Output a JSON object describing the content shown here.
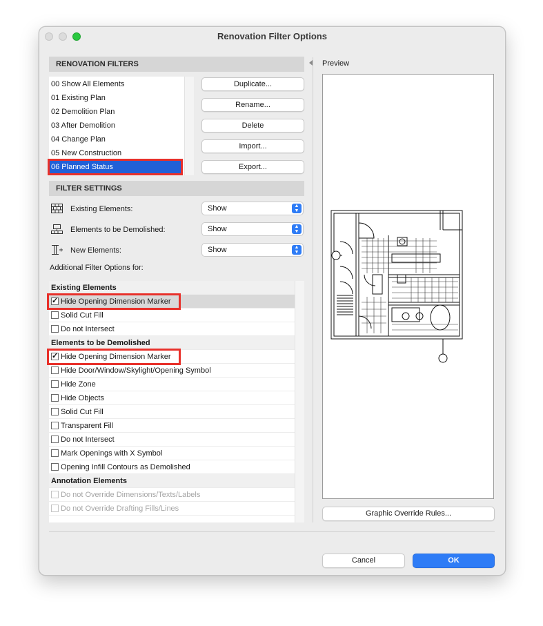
{
  "window": {
    "title": "Renovation Filter Options"
  },
  "renovation_filters": {
    "header": "RENOVATION FILTERS",
    "items": [
      {
        "label": "00 Show All Elements"
      },
      {
        "label": "01 Existing Plan"
      },
      {
        "label": "02 Demolition Plan"
      },
      {
        "label": "03 After Demolition"
      },
      {
        "label": "04 Change Plan"
      },
      {
        "label": "05 New Construction"
      },
      {
        "label": "06 Planned Status"
      }
    ],
    "selected_index": 6,
    "buttons": {
      "duplicate": "Duplicate...",
      "rename": "Rename...",
      "delete": "Delete",
      "import": "Import...",
      "export": "Export..."
    }
  },
  "filter_settings": {
    "header": "FILTER SETTINGS",
    "rows": [
      {
        "label": "Existing Elements:",
        "value": "Show",
        "icon": "brick-wall-icon"
      },
      {
        "label": "Elements to be Demolished:",
        "value": "Show",
        "icon": "demolish-icon"
      },
      {
        "label": "New Elements:",
        "value": "Show",
        "icon": "new-column-icon"
      }
    ],
    "additional_label": "Additional Filter Options for:"
  },
  "options": {
    "groups": [
      {
        "title": "Existing Elements",
        "items": [
          {
            "label": "Hide Opening Dimension Marker",
            "checked": true
          },
          {
            "label": "Solid Cut Fill",
            "checked": false
          },
          {
            "label": "Do not Intersect",
            "checked": false
          }
        ]
      },
      {
        "title": "Elements to be Demolished",
        "items": [
          {
            "label": "Hide Opening Dimension Marker",
            "checked": true
          },
          {
            "label": "Hide Door/Window/Skylight/Opening Symbol",
            "checked": false
          },
          {
            "label": "Hide Zone",
            "checked": false
          },
          {
            "label": "Hide Objects",
            "checked": false
          },
          {
            "label": "Solid Cut Fill",
            "checked": false
          },
          {
            "label": "Transparent Fill",
            "checked": false
          },
          {
            "label": "Do not Intersect",
            "checked": false
          },
          {
            "label": "Mark Openings with X Symbol",
            "checked": false
          },
          {
            "label": "Opening Infill Contours as Demolished",
            "checked": false
          }
        ]
      },
      {
        "title": "Annotation Elements",
        "items": [
          {
            "label": "Do not Override Dimensions/Texts/Labels",
            "checked": false,
            "disabled": true
          },
          {
            "label": "Do not Override Drafting Fills/Lines",
            "checked": false,
            "disabled": true
          }
        ]
      }
    ]
  },
  "preview": {
    "label": "Preview",
    "graphic_override_button": "Graphic Override Rules..."
  },
  "footer": {
    "cancel": "Cancel",
    "ok": "OK"
  },
  "colors": {
    "accent": "#2e7cf6",
    "selection": "#2160d7",
    "highlight": "#e8302a"
  }
}
